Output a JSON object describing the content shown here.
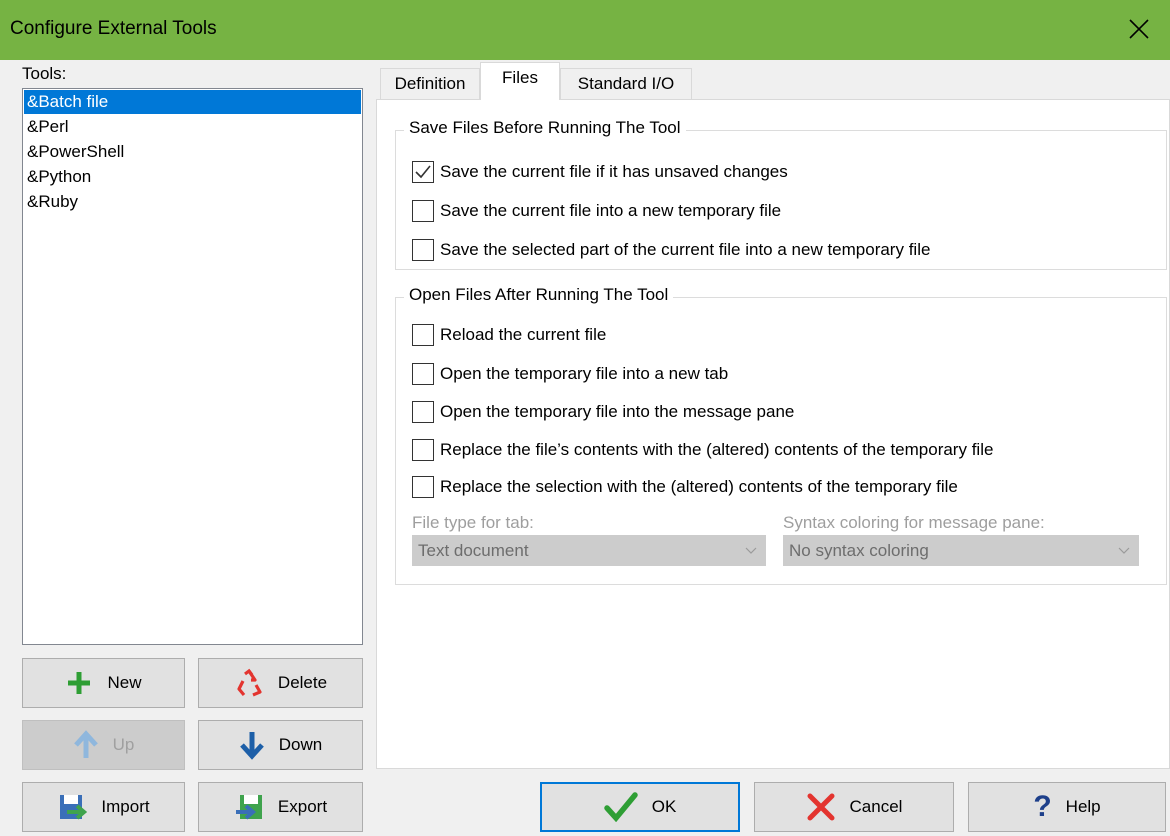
{
  "window": {
    "title": "Configure External Tools"
  },
  "tools": {
    "label": "Tools:",
    "items": [
      "&Batch file",
      "&Perl",
      "&PowerShell",
      "&Python",
      "&Ruby"
    ]
  },
  "buttons": {
    "new": "New",
    "delete": "Delete",
    "up": "Up",
    "down": "Down",
    "import": "Import",
    "export": "Export",
    "ok": "OK",
    "cancel": "Cancel",
    "help": "Help"
  },
  "tabs": [
    "Definition",
    "Files",
    "Standard I/O"
  ],
  "save_group": {
    "title": "Save Files Before Running The Tool",
    "options": [
      {
        "label": "Save the current file if it has unsaved changes",
        "checked": true
      },
      {
        "label": "Save the current file into a new temporary file",
        "checked": false
      },
      {
        "label": "Save the selected part of the current file into a new temporary file",
        "checked": false
      }
    ]
  },
  "open_group": {
    "title": "Open Files After Running The Tool",
    "options": [
      {
        "label": "Reload the current file",
        "checked": false
      },
      {
        "label": "Open the temporary file into a new tab",
        "checked": false
      },
      {
        "label": "Open the temporary file into the message pane",
        "checked": false
      },
      {
        "label": "Replace the file’s contents with the (altered) contents of the temporary file",
        "checked": false
      },
      {
        "label": "Replace the selection with the (altered) contents of the temporary file",
        "checked": false
      }
    ],
    "file_type_label": "File type for tab:",
    "file_type_value": "Text document",
    "syntax_label": "Syntax coloring for message pane:",
    "syntax_value": "No syntax coloring"
  },
  "colors": {
    "titlebar": "#76b343",
    "selection": "#0078d7"
  }
}
